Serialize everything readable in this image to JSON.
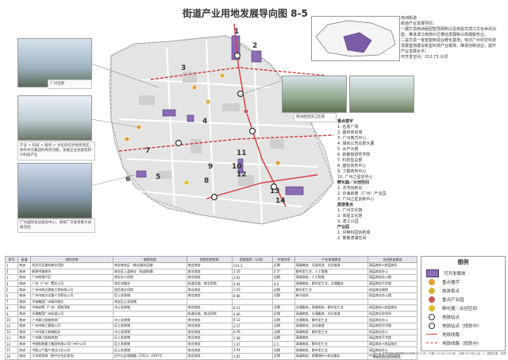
{
  "title": "街道产业用地发展导向图 8-5",
  "info": {
    "area_name": "南洲街道",
    "position_heading": "街道产业发展导向：",
    "position_text": "一展打造南洲组团智慧网购以及体验式滨江文化休闲功能，推进滨江南部片区带动发展新兴高端服务业。",
    "text2": "二是打造一批智能制造业孵化基地，依托广州中交科技发展基地建设新型科技产业载体，推进创新创业，提升产业发展水平。",
    "area_label": "可开发空间：152.73 公顷"
  },
  "keypoints": {
    "group1_title": "重点楼宇",
    "group1_items": [
      "1. 名嘉广场",
      "2. 盛世商贸城",
      "3. 广州南方中心",
      "4. 瑞信公司总部大厦",
      "5. 水产大楼",
      "6. 新都核研究学院",
      "7. 科技型总部",
      "8. 盛信商务中心",
      "9. 丁酮商务中心",
      "10. 广州之星创中心"
    ],
    "group2_title": "孵化器／众创空间",
    "group2_items": [
      "1. 洋湾创新谷",
      "2. 中海启德（广州）产业园",
      "3. 广州之星创新中心"
    ],
    "group3_title": "旅游景点",
    "group3_items": [
      "1. 广州文化馆",
      "2. 体验文化馆",
      "3. 滨江公园"
    ],
    "group4_title": "产业园",
    "group4_items": [
      "1. 洪荣科园创新城",
      "2. 鲁泰滨湖空间"
    ]
  },
  "callouts": {
    "c1": "广州出版",
    "c2": "产业 + 科技 + 服务 + 文化的综合性商务区，依托中交集团的商务功能，发展企业总部及新兴科技产业",
    "c3": "广州国际会议展览中心，承接广交会等重大会展活动",
    "c4": "南洲组团滨江区域"
  },
  "map_numbers": [
    "1",
    "2",
    "3",
    "4",
    "5",
    "6",
    "7",
    "8",
    "9",
    "10",
    "11",
    "12",
    "13",
    "14"
  ],
  "table": {
    "headers": [
      "序号",
      "街道",
      "地块名称",
      "规划用途",
      "控规用地性质",
      "用地面积（公顷）",
      "开发时序",
      "产业用地建设",
      "空间形态建议"
    ],
    "rows": [
      [
        "1",
        "南洲",
        "东风片区服务商业用地",
        "商业商务区（商业服务设施）",
        "商业商务",
        "114.3",
        "近期",
        "高端商务、总部经济、文化旅游",
        "高层商务+底层商业"
      ],
      [
        "2",
        "南洲",
        "新港中路地块",
        "商业区上盖物业（轨道联通）",
        "商业商务",
        "2.16",
        "2.5*",
        "都市型工业、人工智能",
        "高层商务办公"
      ],
      [
        "3",
        "南洲",
        "广州南港片区",
        "商业办公用地",
        "商业商务",
        "3.02",
        "远期",
        "高端商务、人工智能",
        "高层商务办公楼"
      ],
      [
        "4",
        "南洲",
        "广州（广州）置业公司",
        "商业金融业",
        "轨道设施、商业用地",
        "4.94",
        "4.0",
        "高端商务、都市型工业、交通服务",
        "高层商务写字楼"
      ],
      [
        "5",
        "南洲",
        "广州市南方建筑工程有限公司",
        "居住商业用地",
        "商业商务",
        "1.03",
        "远期",
        "都市型工业",
        "低层商业建筑"
      ],
      [
        "6",
        "南洲",
        "广州市南方达路人才职业公司",
        "区土发收储",
        "商业商务",
        "0.96",
        "远期",
        "新兴科技",
        "低层商业办公楼"
      ],
      [
        "7",
        "南洲",
        "中海集团广州城市物业",
        "商业区土发收储",
        "",
        "",
        "",
        "",
        ""
      ],
      [
        "8",
        "南洲",
        "中海启德（广州）规划用地",
        "市土发收储",
        "商业商务",
        "6.21",
        "近期",
        "交通服务、高端商务、都市型工业",
        "高层商务+底层商业"
      ],
      [
        "9",
        "南洲",
        "交通集团广州轨道公司",
        "",
        "轨道设施、商业用地",
        "4.06",
        "近期",
        "高端商务、交通服务、文化旅游",
        "低层商业综合体"
      ],
      [
        "10",
        "南洲",
        "广州珠江船舶修造厂",
        "市土发收储",
        "商业商务",
        "0.12",
        "远期",
        "交通服务、都市型工业",
        "低层商业办公"
      ],
      [
        "11",
        "南洲",
        "广州市珠江管理公司",
        "区土发收储",
        "商业商务",
        "2.57",
        "远期",
        "高端商务、文化旅游",
        "高层商务写字楼"
      ],
      [
        "12",
        "南洲",
        "广州市珠江新城船务",
        "市土发收储",
        "商业商务",
        "0.29",
        "远期",
        "高端商务、都市型工业",
        "低层商业办公"
      ],
      [
        "13",
        "南洲",
        "广州珠江船舶修造厂",
        "区土发收储",
        "商业商务",
        "2.38",
        "远期",
        "高端商务",
        "高层商务写字楼"
      ],
      [
        "14",
        "南洲",
        "中国船舶重工集团有限公司广州分公司",
        "区土发收储",
        "商业商务",
        "1.07",
        "2.5",
        "高端商务、都市型工业",
        "高层商务+底层商业"
      ],
      [
        "15",
        "南洲",
        "中国土产畜产进出口总公司",
        "区土发收储",
        "商业商务",
        "3.54",
        "远期",
        "高端商务、都市型工业",
        "高层商务办公"
      ],
      [
        "16",
        "南洲",
        "大功商贸城（原中交社区地块）",
        "区中心区域储备［2012］2397号",
        "商业商务",
        "1.62",
        "近期",
        "高端商务、智慧城市+商业服务",
        "中高层商务+底层商业"
      ]
    ]
  },
  "legend": {
    "title": "图例",
    "items": [
      {
        "label": "可开发载体",
        "kind": "box",
        "color": "#8c6cb6"
      },
      {
        "label": "重点楼宇",
        "kind": "dot",
        "color": "#e5a23a"
      },
      {
        "label": "旅游景点",
        "kind": "dot",
        "color": "#d8b040"
      },
      {
        "label": "重点产业园",
        "kind": "dot",
        "color": "#c85a5a"
      },
      {
        "label": "孵化器／众创空间",
        "kind": "dot",
        "color": "#e0c030"
      },
      {
        "label": "地铁站点",
        "kind": "ring",
        "color": "#333333"
      },
      {
        "label": "地铁站点（规划中）",
        "kind": "ring",
        "color": "#333333"
      },
      {
        "label": "地铁线路",
        "kind": "line",
        "color": "#d63a3a"
      },
      {
        "label": "地铁线路（规划中）",
        "kind": "dash",
        "color": "#d63a3a"
      }
    ]
  },
  "footnote": "注：1. 开发时序分类依据 2018年-2021年，中期 2021年-2025年，远期 2025年以后；2. 建筑密度、容积率等规划指标仅供参考。"
}
